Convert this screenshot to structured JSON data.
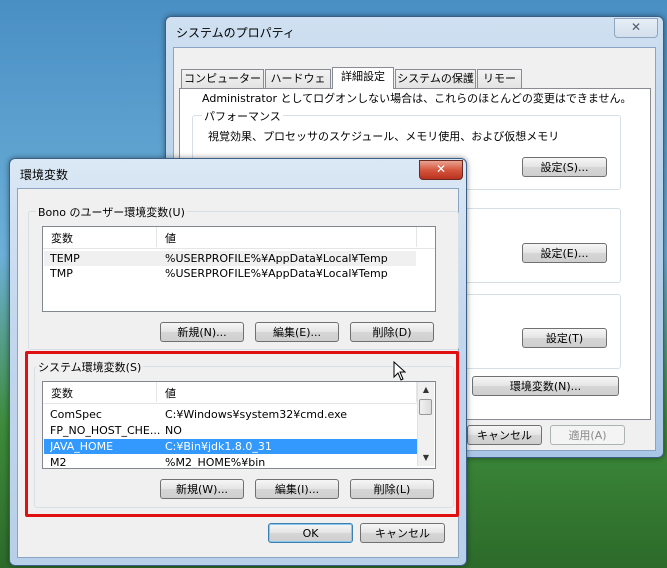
{
  "sys_props": {
    "title": "システムのプロパティ",
    "close": "✕",
    "tabs": [
      "コンピューター名",
      "ハードウェア",
      "詳細設定",
      "システムの保護",
      "リモート"
    ],
    "note": "Administrator としてログオンしない場合は、これらのほとんどの変更はできません。",
    "perf_group": "パフォーマンス",
    "perf_desc": "視覚効果、プロセッサのスケジュール、メモリ使用、および仮想メモリ",
    "settings_s": "設定(S)...",
    "settings_e": "設定(E)...",
    "settings_t": "設定(T)",
    "env_button": "環境変数(N)...",
    "cancel": "キャンセル",
    "apply": "適用(A)"
  },
  "env": {
    "title": "環境変数",
    "close": "✕",
    "user_group": "Bono のユーザー環境変数(U)",
    "col_var": "変数",
    "col_val": "値",
    "user_vars": [
      {
        "name": "TEMP",
        "value": "%USERPROFILE%¥AppData¥Local¥Temp"
      },
      {
        "name": "TMP",
        "value": "%USERPROFILE%¥AppData¥Local¥Temp"
      }
    ],
    "user_new": "新規(N)...",
    "user_edit": "編集(E)...",
    "user_delete": "削除(D)",
    "sys_group": "システム環境変数(S)",
    "sys_vars": [
      {
        "name": "ComSpec",
        "value": "C:¥Windows¥system32¥cmd.exe"
      },
      {
        "name": "FP_NO_HOST_CHE...",
        "value": "NO"
      },
      {
        "name": "JAVA_HOME",
        "value": "C:¥Bin¥jdk1.8.0_31"
      },
      {
        "name": "M2",
        "value": "%M2_HOME%¥bin"
      }
    ],
    "sys_new": "新規(W)...",
    "sys_edit": "編集(I)...",
    "sys_delete": "削除(L)",
    "ok": "OK",
    "cancel": "キャンセル"
  },
  "colors": {
    "highlight_box": "#e01010",
    "selection": "#3399ff"
  }
}
